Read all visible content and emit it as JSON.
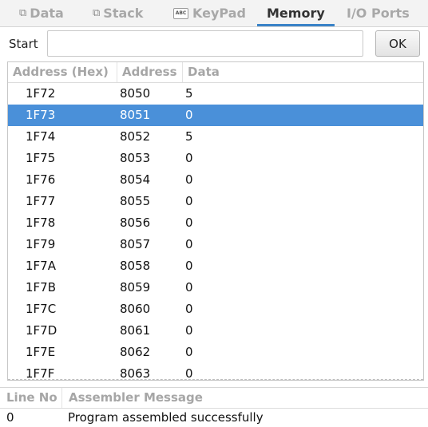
{
  "tabs": [
    {
      "label": "Data",
      "icon": "cubes-icon"
    },
    {
      "label": "Stack",
      "icon": "cubes-icon"
    },
    {
      "label": "KeyPad",
      "icon": "abc-keypad-icon",
      "icon_text": "ABC"
    },
    {
      "label": "Memory",
      "active": true
    },
    {
      "label": "I/O Ports"
    }
  ],
  "start": {
    "label": "Start",
    "value": "",
    "ok_label": "OK"
  },
  "memory_table": {
    "headers": [
      "Address (Hex)",
      "Address",
      "Data"
    ],
    "selected_index": 1,
    "rows": [
      {
        "hex": "1F72",
        "address": "8050",
        "data": "5"
      },
      {
        "hex": "1F73",
        "address": "8051",
        "data": "0"
      },
      {
        "hex": "1F74",
        "address": "8052",
        "data": "5"
      },
      {
        "hex": "1F75",
        "address": "8053",
        "data": "0"
      },
      {
        "hex": "1F76",
        "address": "8054",
        "data": "0"
      },
      {
        "hex": "1F77",
        "address": "8055",
        "data": "0"
      },
      {
        "hex": "1F78",
        "address": "8056",
        "data": "0"
      },
      {
        "hex": "1F79",
        "address": "8057",
        "data": "0"
      },
      {
        "hex": "1F7A",
        "address": "8058",
        "data": "0"
      },
      {
        "hex": "1F7B",
        "address": "8059",
        "data": "0"
      },
      {
        "hex": "1F7C",
        "address": "8060",
        "data": "0"
      },
      {
        "hex": "1F7D",
        "address": "8061",
        "data": "0"
      },
      {
        "hex": "1F7E",
        "address": "8062",
        "data": "0"
      },
      {
        "hex": "1F7F",
        "address": "8063",
        "data": "0"
      }
    ]
  },
  "messages": {
    "headers": [
      "Line No",
      "Assembler Message"
    ],
    "rows": [
      {
        "line": "0",
        "message": "Program assembled successfully"
      }
    ]
  },
  "colors": {
    "selection": "#4a90d9",
    "active_tab_underline": "#3a83c8"
  }
}
